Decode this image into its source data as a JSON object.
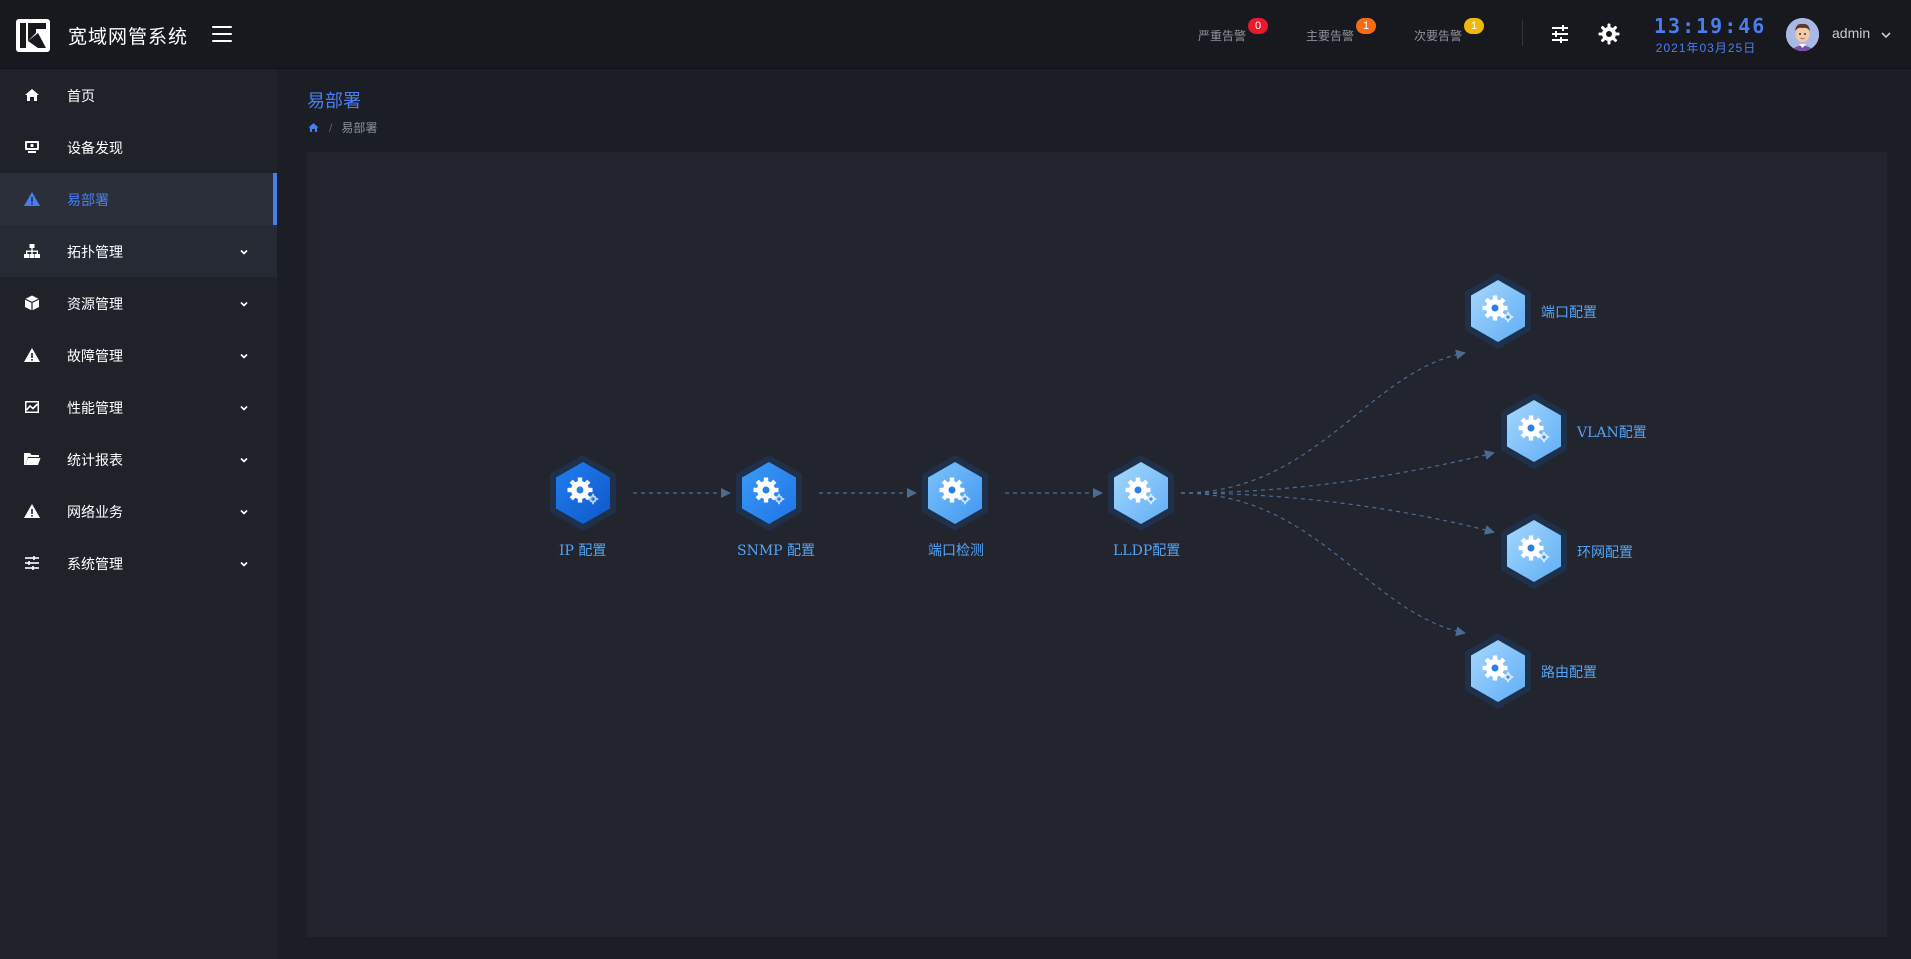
{
  "app": {
    "title": "宽域网管系统"
  },
  "alarms": [
    {
      "label": "严重告警",
      "count": "0",
      "color": "#e8192c"
    },
    {
      "label": "主要告警",
      "count": "1",
      "color": "#f56c17"
    },
    {
      "label": "次要告警",
      "count": "1",
      "color": "#f0b70c"
    }
  ],
  "clock": {
    "time": "13:19:46",
    "date": "2021年03月25日"
  },
  "user": {
    "name": "admin"
  },
  "sidebar": {
    "items": [
      {
        "label": "首页",
        "icon": "home-icon"
      },
      {
        "label": "设备发现",
        "icon": "monitor-icon"
      },
      {
        "label": "易部署",
        "icon": "warning-icon",
        "active": true
      },
      {
        "label": "拓扑管理",
        "icon": "topology-icon",
        "expandable": true
      },
      {
        "label": "资源管理",
        "icon": "box-icon",
        "expandable": true
      },
      {
        "label": "故障管理",
        "icon": "warning-icon",
        "expandable": true
      },
      {
        "label": "性能管理",
        "icon": "chart-icon",
        "expandable": true
      },
      {
        "label": "统计报表",
        "icon": "folder-icon",
        "expandable": true
      },
      {
        "label": "网络业务",
        "icon": "warning-icon",
        "expandable": true
      },
      {
        "label": "系统管理",
        "icon": "sliders-icon",
        "expandable": true
      }
    ]
  },
  "page": {
    "title": "易部署",
    "breadcrumb": [
      "易部署"
    ]
  },
  "flow": {
    "steps": [
      "IP 配置",
      "SNMP 配置",
      "端口检测",
      "LLDP配置"
    ],
    "branches": [
      "端口配置",
      "VLAN配置",
      "环网配置",
      "路由配置"
    ]
  },
  "colors": {
    "accent": "#4a7ef0",
    "node_dark": "#1668d8",
    "node_mid": "#2b8af0",
    "node_light": "#60b2f7",
    "node_pale": "#8ccbfb",
    "label": "#55a3f5"
  }
}
